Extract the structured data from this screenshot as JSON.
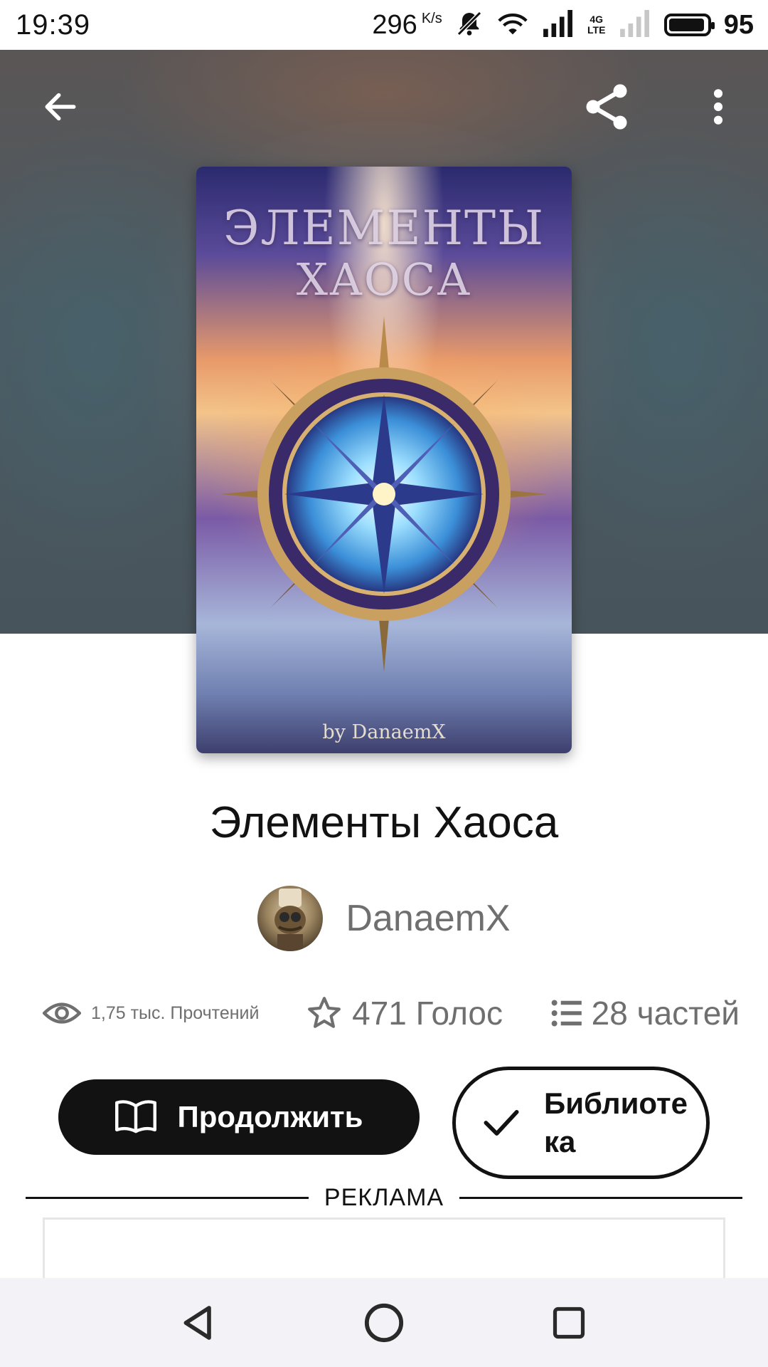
{
  "status_bar": {
    "time": "19:39",
    "net_speed": "296",
    "net_unit": "K/s",
    "network_type": "4G LTE",
    "battery": "95"
  },
  "book": {
    "cover_title_line1": "ЭЛЕМЕНТЫ",
    "cover_title_line2": "ХАОСА",
    "cover_author": "by DanaemX",
    "title": "Элементы Хаоса",
    "author": "DanaemX"
  },
  "stats": {
    "reads": "1,75 тыс. Прочтений",
    "votes": "471 Голос",
    "parts": "28 частей"
  },
  "actions": {
    "continue_label": "Продолжить",
    "library_label": "Библиотека"
  },
  "ad": {
    "label": "РЕКЛАМА"
  },
  "icons": {
    "back": "arrow-left-icon",
    "share": "share-icon",
    "more": "more-vert-icon",
    "reads": "eye-icon",
    "votes": "star-icon",
    "parts": "list-icon",
    "continue": "open-book-icon",
    "library": "check-icon"
  },
  "colors": {
    "primary_button": "#121212",
    "secondary_text": "#6f6f6f",
    "nav_bar": "#f3f2f6"
  }
}
